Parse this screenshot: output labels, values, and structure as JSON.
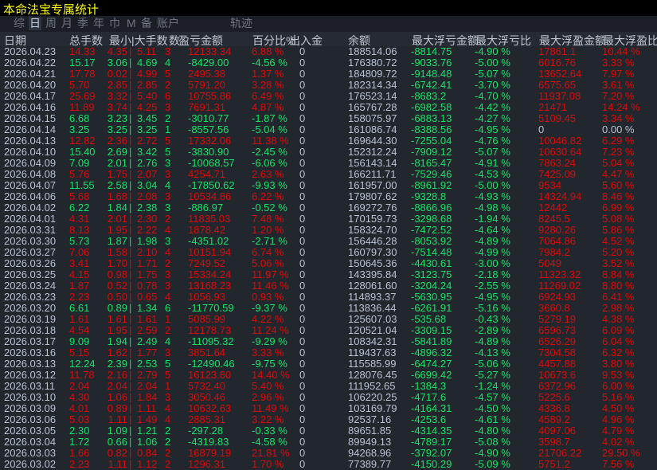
{
  "title": "本命法宝专属统计",
  "tabs": [
    {
      "label": "综",
      "active": false
    },
    {
      "label": "日",
      "active": true
    },
    {
      "label": "周",
      "active": false
    },
    {
      "label": "月",
      "active": false
    },
    {
      "label": "季",
      "active": false
    },
    {
      "label": "年",
      "active": false
    },
    {
      "label": "巾",
      "active": false
    },
    {
      "label": "M",
      "active": false
    },
    {
      "label": "备",
      "active": false
    },
    {
      "label": "账户",
      "active": false
    },
    {
      "label": "轨迹",
      "active": false
    }
  ],
  "columns": [
    "日期",
    "总手数",
    "最小|大手数",
    "数",
    "盈亏金额",
    "百分比%",
    "出入金",
    "余额",
    "最大浮亏金额",
    "最大浮亏比",
    "最大浮盈金额",
    "最大浮盈比"
  ],
  "separator": "|",
  "colors": {
    "profit": "#dd0a0a",
    "loss": "#12e46a",
    "neutral": "#b8c2d4",
    "title": "#ffff00"
  },
  "rows": [
    [
      "2026.04.23",
      "14.33",
      "4.35",
      "5.11",
      "3",
      "12133.34",
      "6.88 %",
      "0",
      "188514.06",
      "-8814.75",
      "-4.90 %",
      "17861.1",
      "10.44 %"
    ],
    [
      "2026.04.22",
      "15.17",
      "3.06",
      "4.69",
      "4",
      "-8429.00",
      "-4.56 %",
      "0",
      "176380.72",
      "-9033.76",
      "-5.00 %",
      "6016.76",
      "3.33 %"
    ],
    [
      "2026.04.21",
      "17.78",
      "0.02",
      "4.99",
      "5",
      "2495.38",
      "1.37 %",
      "0",
      "184809.72",
      "-9148.48",
      "-5.07 %",
      "13652.64",
      "7.97 %"
    ],
    [
      "2026.04.20",
      "5.70",
      "2.85",
      "2.85",
      "2",
      "5791.20",
      "3.28 %",
      "0",
      "182314.34",
      "-6742.41",
      "-3.70 %",
      "6575.65",
      "3.61 %"
    ],
    [
      "2026.04.17",
      "25.69",
      "3.32",
      "5.40",
      "6",
      "10755.86",
      "6.49 %",
      "0",
      "176523.14",
      "-8683.2",
      "-4.70 %",
      "11937.08",
      "7.20 %"
    ],
    [
      "2026.04.16",
      "11.89",
      "3.74",
      "4.25",
      "3",
      "7691.31",
      "4.87 %",
      "0",
      "165767.28",
      "-6982.58",
      "-4.42 %",
      "21471",
      "14.24 %"
    ],
    [
      "2026.04.15",
      "6.68",
      "3.23",
      "3.45",
      "2",
      "-3010.77",
      "-1.87 %",
      "0",
      "158075.97",
      "-6883.13",
      "-4.27 %",
      "5109.45",
      "3.34 %"
    ],
    [
      "2026.04.14",
      "3.25",
      "3.25",
      "3.25",
      "1",
      "-8557.56",
      "-5.04 %",
      "0",
      "161086.74",
      "-8388.56",
      "-4.95 %",
      "0",
      "0.00 %"
    ],
    [
      "2026.04.13",
      "12.82",
      "2.36",
      "2.72",
      "5",
      "17332.06",
      "11.38 %",
      "0",
      "169644.30",
      "-7255.04",
      "-4.76 %",
      "10046.82",
      "6.29 %"
    ],
    [
      "2026.04.10",
      "15.40",
      "2.69",
      "3.42",
      "5",
      "-3830.90",
      "-2.45 %",
      "0",
      "152312.24",
      "-7909.12",
      "-5.07 %",
      "10630.64",
      "7.23 %"
    ],
    [
      "2026.04.09",
      "7.09",
      "2.01",
      "2.76",
      "3",
      "-10068.57",
      "-6.06 %",
      "0",
      "156143.14",
      "-8165.47",
      "-4.91 %",
      "7863.24",
      "5.04 %"
    ],
    [
      "2026.04.08",
      "5.76",
      "1.75",
      "2.07",
      "3",
      "4254.71",
      "2.63 %",
      "0",
      "166211.71",
      "-7529.46",
      "-4.53 %",
      "7425.09",
      "4.47 %"
    ],
    [
      "2026.04.07",
      "11.55",
      "2.58",
      "3.04",
      "4",
      "-17850.62",
      "-9.93 %",
      "0",
      "161957.00",
      "-8961.92",
      "-5.00 %",
      "9534",
      "5.60 %"
    ],
    [
      "2026.04.06",
      "5.68",
      "1.68",
      "2.08",
      "3",
      "10534.86",
      "6.22 %",
      "0",
      "179807.62",
      "-9328.8",
      "-4.93 %",
      "14324.94",
      "8.46 %"
    ],
    [
      "2026.04.02",
      "6.22",
      "1.84",
      "2.38",
      "3",
      "-886.97",
      "-0.52 %",
      "0",
      "169272.76",
      "-8866.96",
      "-4.98 %",
      "12442",
      "6.99 %"
    ],
    [
      "2026.04.01",
      "4.31",
      "2.01",
      "2.30",
      "2",
      "11835.03",
      "7.48 %",
      "0",
      "170159.73",
      "-3298.68",
      "-1.94 %",
      "8245.5",
      "5.08 %"
    ],
    [
      "2026.03.31",
      "8.13",
      "1.95",
      "2.22",
      "4",
      "1878.42",
      "1.20 %",
      "0",
      "158324.70",
      "-7472.52",
      "-4.64 %",
      "9280.26",
      "5.86 %"
    ],
    [
      "2026.03.30",
      "5.73",
      "1.87",
      "1.98",
      "3",
      "-4351.02",
      "-2.71 %",
      "0",
      "156446.28",
      "-8053.92",
      "-4.89 %",
      "7064.86",
      "4.52 %"
    ],
    [
      "2026.03.27",
      "7.06",
      "1.58",
      "2.10",
      "4",
      "10151.94",
      "6.74 %",
      "0",
      "160797.30",
      "-7514.48",
      "-4.99 %",
      "7984.2",
      "5.20 %"
    ],
    [
      "2026.03.26",
      "3.41",
      "1.70",
      "1.71",
      "2",
      "7249.52",
      "5.06 %",
      "0",
      "150645.36",
      "-4430.61",
      "-3.00 %",
      "5049",
      "3.52 %"
    ],
    [
      "2026.03.25",
      "4.15",
      "0.98",
      "1.75",
      "3",
      "15334.24",
      "11.97 %",
      "0",
      "143395.84",
      "-3123.75",
      "-2.18 %",
      "11323.32",
      "8.84 %"
    ],
    [
      "2026.03.24",
      "1.87",
      "0.52",
      "0.78",
      "3",
      "13168.23",
      "11.46 %",
      "0",
      "128061.60",
      "-3204.24",
      "-2.55 %",
      "11269.02",
      "8.80 %"
    ],
    [
      "2026.03.23",
      "2.23",
      "0.50",
      "0.65",
      "4",
      "1056.93",
      "0.93 %",
      "0",
      "114893.37",
      "-5630.95",
      "-4.95 %",
      "6924.93",
      "6.41 %"
    ],
    [
      "2026.03.20",
      "6.61",
      "0.89",
      "1.34",
      "6",
      "-11770.59",
      "-9.37 %",
      "0",
      "113836.44",
      "-6261.91",
      "-5.16 %",
      "3660.8",
      "2.98 %"
    ],
    [
      "2026.03.19",
      "1.61",
      "1.61",
      "1.61",
      "1",
      "5085.99",
      "4.22 %",
      "0",
      "125607.03",
      "-535.68",
      "-0.43 %",
      "5279.19",
      "4.38 %"
    ],
    [
      "2026.03.18",
      "4.54",
      "1.95",
      "2.59",
      "2",
      "12178.73",
      "11.24 %",
      "0",
      "120521.04",
      "-3309.15",
      "-2.89 %",
      "6596.73",
      "6.09 %"
    ],
    [
      "2026.03.17",
      "9.09",
      "1.94",
      "2.49",
      "4",
      "-11095.32",
      "-9.29 %",
      "0",
      "108342.31",
      "-5841.89",
      "-4.89 %",
      "6526.29",
      "6.04 %"
    ],
    [
      "2026.03.16",
      "5.15",
      "1.62",
      "1.77",
      "3",
      "3851.64",
      "3.33 %",
      "0",
      "119437.63",
      "-4896.32",
      "-4.13 %",
      "7304.58",
      "6.32 %"
    ],
    [
      "2026.03.13",
      "12.24",
      "2.39",
      "2.53",
      "5",
      "-12490.46",
      "-9.75 %",
      "0",
      "115585.99",
      "-6474.27",
      "-5.06 %",
      "4457.88",
      "3.80 %"
    ],
    [
      "2026.03.12",
      "11.78",
      "2.16",
      "2.79",
      "5",
      "16123.80",
      "14.40 %",
      "0",
      "128076.45",
      "-6699.42",
      "-5.27 %",
      "10673.6",
      "9.53 %"
    ],
    [
      "2026.03.11",
      "2.04",
      "2.04",
      "2.04",
      "1",
      "5732.40",
      "5.40 %",
      "0",
      "111952.65",
      "-1384.3",
      "-1.24 %",
      "6372.96",
      "6.00 %"
    ],
    [
      "2026.03.10",
      "4.30",
      "1.06",
      "1.84",
      "3",
      "3050.46",
      "2.96 %",
      "0",
      "106220.25",
      "-4717.6",
      "-4.57 %",
      "5225.6",
      "5.16 %"
    ],
    [
      "2026.03.09",
      "4.01",
      "0.89",
      "1.11",
      "4",
      "10632.63",
      "11.49 %",
      "0",
      "103169.79",
      "-4164.31",
      "-4.50 %",
      "4336.8",
      "4.50 %"
    ],
    [
      "2026.03.06",
      "5.03",
      "1.11",
      "1.49",
      "4",
      "2885.31",
      "3.22 %",
      "0",
      "92537.16",
      "-4253.6",
      "-4.61 %",
      "4589.2",
      "4.96 %"
    ],
    [
      "2026.03.05",
      "2.30",
      "1.09",
      "1.21",
      "2",
      "-297.28",
      "-0.33 %",
      "0",
      "89651.85",
      "-4314.35",
      "-4.80 %",
      "4097.06",
      "4.79 %"
    ],
    [
      "2026.03.04",
      "1.72",
      "0.66",
      "1.06",
      "2",
      "-4319.83",
      "-4.58 %",
      "0",
      "89949.13",
      "-4789.17",
      "-5.08 %",
      "3598.7",
      "4.02 %"
    ],
    [
      "2026.03.03",
      "1.66",
      "0.82",
      "0.84",
      "2",
      "16879.19",
      "21.81 %",
      "0",
      "94268.96",
      "-3792.07",
      "-4.90 %",
      "21706.22",
      "29.50 %"
    ],
    [
      "2026.03.02",
      "2.23",
      "1.11",
      "1.12",
      "2",
      "1296.31",
      "1.70 %",
      "0",
      "77389.77",
      "-4150.29",
      "-5.09 %",
      "5751.2",
      "7.56 %"
    ]
  ]
}
